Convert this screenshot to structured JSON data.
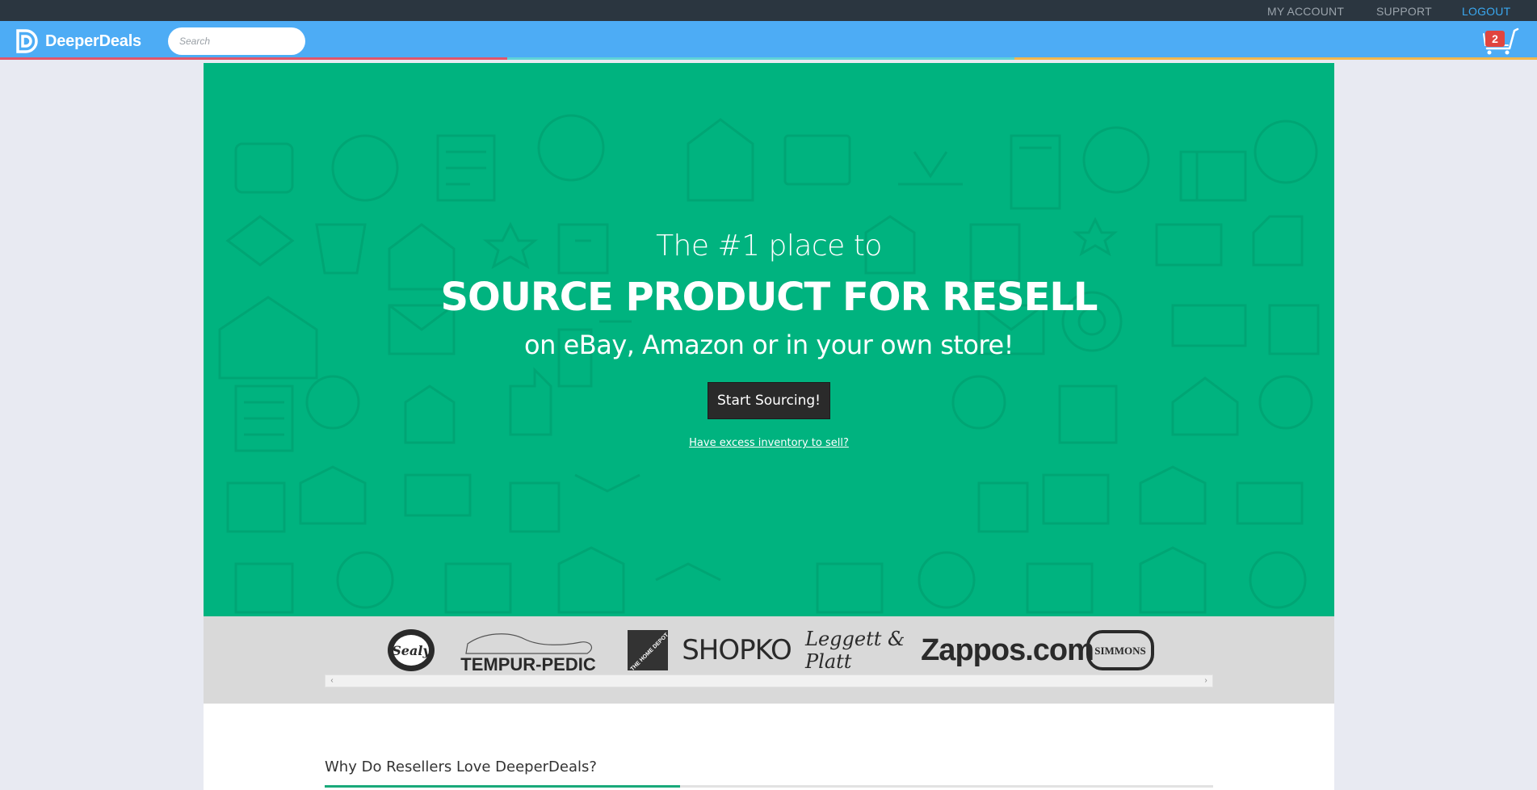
{
  "topbar": {
    "my_account": "MY ACCOUNT",
    "support": "SUPPORT",
    "logout": "LOGOUT"
  },
  "navbar": {
    "logo_text": "DeeperDeals",
    "search_placeholder": "Search",
    "cart_count": "2"
  },
  "hero": {
    "line1": "The #1 place to",
    "line2": "SOURCE PRODUCT FOR RESELL",
    "line3": "on eBay, Amazon or in your own store!",
    "cta_label": "Start Sourcing!",
    "sell_link": "Have excess inventory to sell?"
  },
  "brands": {
    "items": [
      "Sealy",
      "TEMPUR-PEDIC",
      "THE HOME DEPOT",
      "SHOPKO",
      "Leggett & Platt",
      "Zappos.com",
      "SIMMONS"
    ]
  },
  "why": {
    "title": "Why Do Resellers Love DeeperDeals?"
  },
  "colors": {
    "topbar": "#2b3640",
    "navbar": "#4dacf5",
    "hero": "#00b37f",
    "cta": "#2a2a2a",
    "accent": "#19a97a"
  }
}
